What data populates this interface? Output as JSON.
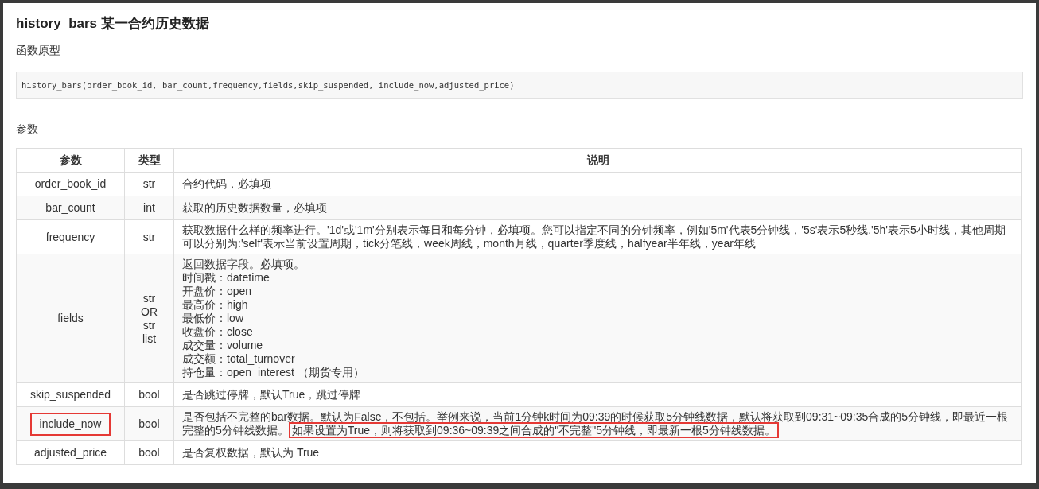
{
  "title": {
    "name": "history_bars",
    "subtitle": "某一合约历史数据"
  },
  "prototype_label": "函数原型",
  "code": "history_bars(order_book_id, bar_count,frequency,fields,skip_suspended, include_now,adjusted_price)",
  "params_label": "参数",
  "table": {
    "columns": [
      "参数",
      "类型",
      "说明"
    ],
    "rows": [
      {
        "param": "order_book_id",
        "highlighted": false,
        "type": [
          "str"
        ],
        "kind": "text",
        "description": "合约代码，必填项"
      },
      {
        "param": "bar_count",
        "highlighted": false,
        "type": [
          "int"
        ],
        "kind": "text",
        "description": "获取的历史数据数量，必填项"
      },
      {
        "param": "frequency",
        "highlighted": false,
        "type": [
          "str"
        ],
        "kind": "text",
        "description": "获取数据什么样的频率进行。'1d'或'1m'分别表示每日和每分钟，必填项。您可以指定不同的分钟频率，例如'5m'代表5分钟线，'5s'表示5秒线,'5h'表示5小时线，其他周期可以分别为:'self'表示当前设置周期，tick分笔线，week周线，month月线，quarter季度线，halfyear半年线，year年线"
      },
      {
        "param": "fields",
        "highlighted": false,
        "type": [
          "str",
          "OR",
          "str",
          "list"
        ],
        "kind": "lines",
        "lines": [
          "返回数据字段。必填项。",
          "时间戳：datetime",
          "开盘价：open",
          "最高价：high",
          "最低价：low",
          "收盘价：close",
          "成交量：volume",
          "成交额：total_turnover",
          "持仓量：open_interest （期货专用）"
        ]
      },
      {
        "param": "skip_suspended",
        "highlighted": false,
        "type": [
          "bool"
        ],
        "kind": "text",
        "description": "是否跳过停牌，默认True，跳过停牌"
      },
      {
        "param": "include_now",
        "highlighted": true,
        "type": [
          "bool"
        ],
        "kind": "text",
        "description": "是否包括不完整的bar数据。默认为False，不包括。举例来说，当前1分钟k时间为09:39的时候获取5分钟线数据，默认将获取到09:31~09:35合成的5分钟线，即最近一根完整的5分钟线数据。",
        "highlight": "如果设置为True，则将获取到09:36~09:39之间合成的\"不完整\"5分钟线，即最新一根5分钟线数据。"
      },
      {
        "param": "adjusted_price",
        "highlighted": false,
        "type": [
          "bool"
        ],
        "kind": "text",
        "description": "是否复权数据，默认为 True"
      }
    ]
  }
}
